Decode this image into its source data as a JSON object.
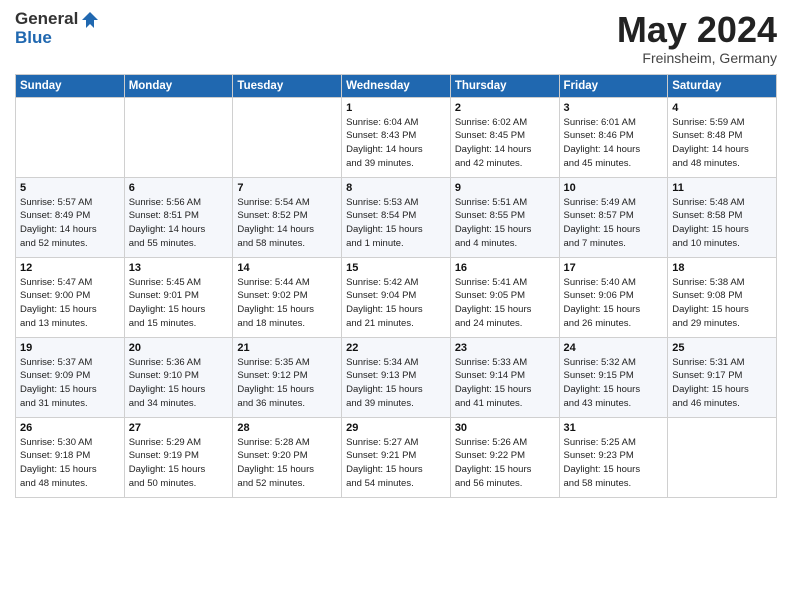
{
  "logo": {
    "general": "General",
    "blue": "Blue"
  },
  "title": {
    "month": "May 2024",
    "location": "Freinsheim, Germany"
  },
  "weekdays": [
    "Sunday",
    "Monday",
    "Tuesday",
    "Wednesday",
    "Thursday",
    "Friday",
    "Saturday"
  ],
  "weeks": [
    [
      {
        "day": "",
        "info": ""
      },
      {
        "day": "",
        "info": ""
      },
      {
        "day": "",
        "info": ""
      },
      {
        "day": "1",
        "info": "Sunrise: 6:04 AM\nSunset: 8:43 PM\nDaylight: 14 hours\nand 39 minutes."
      },
      {
        "day": "2",
        "info": "Sunrise: 6:02 AM\nSunset: 8:45 PM\nDaylight: 14 hours\nand 42 minutes."
      },
      {
        "day": "3",
        "info": "Sunrise: 6:01 AM\nSunset: 8:46 PM\nDaylight: 14 hours\nand 45 minutes."
      },
      {
        "day": "4",
        "info": "Sunrise: 5:59 AM\nSunset: 8:48 PM\nDaylight: 14 hours\nand 48 minutes."
      }
    ],
    [
      {
        "day": "5",
        "info": "Sunrise: 5:57 AM\nSunset: 8:49 PM\nDaylight: 14 hours\nand 52 minutes."
      },
      {
        "day": "6",
        "info": "Sunrise: 5:56 AM\nSunset: 8:51 PM\nDaylight: 14 hours\nand 55 minutes."
      },
      {
        "day": "7",
        "info": "Sunrise: 5:54 AM\nSunset: 8:52 PM\nDaylight: 14 hours\nand 58 minutes."
      },
      {
        "day": "8",
        "info": "Sunrise: 5:53 AM\nSunset: 8:54 PM\nDaylight: 15 hours\nand 1 minute."
      },
      {
        "day": "9",
        "info": "Sunrise: 5:51 AM\nSunset: 8:55 PM\nDaylight: 15 hours\nand 4 minutes."
      },
      {
        "day": "10",
        "info": "Sunrise: 5:49 AM\nSunset: 8:57 PM\nDaylight: 15 hours\nand 7 minutes."
      },
      {
        "day": "11",
        "info": "Sunrise: 5:48 AM\nSunset: 8:58 PM\nDaylight: 15 hours\nand 10 minutes."
      }
    ],
    [
      {
        "day": "12",
        "info": "Sunrise: 5:47 AM\nSunset: 9:00 PM\nDaylight: 15 hours\nand 13 minutes."
      },
      {
        "day": "13",
        "info": "Sunrise: 5:45 AM\nSunset: 9:01 PM\nDaylight: 15 hours\nand 15 minutes."
      },
      {
        "day": "14",
        "info": "Sunrise: 5:44 AM\nSunset: 9:02 PM\nDaylight: 15 hours\nand 18 minutes."
      },
      {
        "day": "15",
        "info": "Sunrise: 5:42 AM\nSunset: 9:04 PM\nDaylight: 15 hours\nand 21 minutes."
      },
      {
        "day": "16",
        "info": "Sunrise: 5:41 AM\nSunset: 9:05 PM\nDaylight: 15 hours\nand 24 minutes."
      },
      {
        "day": "17",
        "info": "Sunrise: 5:40 AM\nSunset: 9:06 PM\nDaylight: 15 hours\nand 26 minutes."
      },
      {
        "day": "18",
        "info": "Sunrise: 5:38 AM\nSunset: 9:08 PM\nDaylight: 15 hours\nand 29 minutes."
      }
    ],
    [
      {
        "day": "19",
        "info": "Sunrise: 5:37 AM\nSunset: 9:09 PM\nDaylight: 15 hours\nand 31 minutes."
      },
      {
        "day": "20",
        "info": "Sunrise: 5:36 AM\nSunset: 9:10 PM\nDaylight: 15 hours\nand 34 minutes."
      },
      {
        "day": "21",
        "info": "Sunrise: 5:35 AM\nSunset: 9:12 PM\nDaylight: 15 hours\nand 36 minutes."
      },
      {
        "day": "22",
        "info": "Sunrise: 5:34 AM\nSunset: 9:13 PM\nDaylight: 15 hours\nand 39 minutes."
      },
      {
        "day": "23",
        "info": "Sunrise: 5:33 AM\nSunset: 9:14 PM\nDaylight: 15 hours\nand 41 minutes."
      },
      {
        "day": "24",
        "info": "Sunrise: 5:32 AM\nSunset: 9:15 PM\nDaylight: 15 hours\nand 43 minutes."
      },
      {
        "day": "25",
        "info": "Sunrise: 5:31 AM\nSunset: 9:17 PM\nDaylight: 15 hours\nand 46 minutes."
      }
    ],
    [
      {
        "day": "26",
        "info": "Sunrise: 5:30 AM\nSunset: 9:18 PM\nDaylight: 15 hours\nand 48 minutes."
      },
      {
        "day": "27",
        "info": "Sunrise: 5:29 AM\nSunset: 9:19 PM\nDaylight: 15 hours\nand 50 minutes."
      },
      {
        "day": "28",
        "info": "Sunrise: 5:28 AM\nSunset: 9:20 PM\nDaylight: 15 hours\nand 52 minutes."
      },
      {
        "day": "29",
        "info": "Sunrise: 5:27 AM\nSunset: 9:21 PM\nDaylight: 15 hours\nand 54 minutes."
      },
      {
        "day": "30",
        "info": "Sunrise: 5:26 AM\nSunset: 9:22 PM\nDaylight: 15 hours\nand 56 minutes."
      },
      {
        "day": "31",
        "info": "Sunrise: 5:25 AM\nSunset: 9:23 PM\nDaylight: 15 hours\nand 58 minutes."
      },
      {
        "day": "",
        "info": ""
      }
    ]
  ]
}
